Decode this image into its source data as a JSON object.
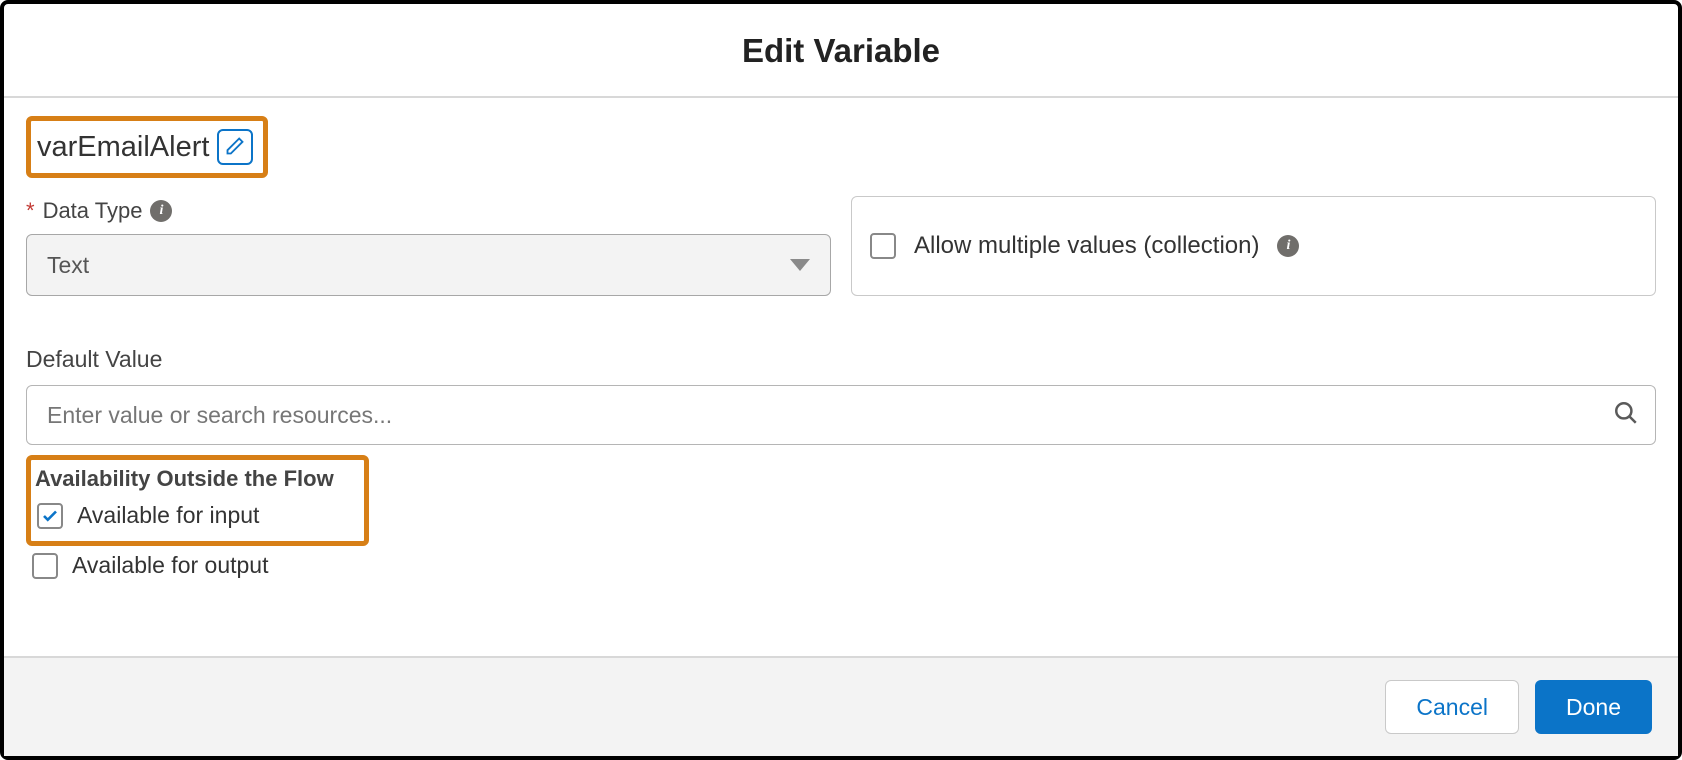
{
  "header": {
    "title": "Edit Variable"
  },
  "variable": {
    "name": "varEmailAlert"
  },
  "dataType": {
    "label": "Data Type",
    "value": "Text"
  },
  "allowMultiple": {
    "label": "Allow multiple values (collection)",
    "checked": false
  },
  "defaultValue": {
    "label": "Default Value",
    "placeholder": "Enter value or search resources..."
  },
  "availability": {
    "title": "Availability Outside the Flow",
    "input": {
      "label": "Available for input",
      "checked": true
    },
    "output": {
      "label": "Available for output",
      "checked": false
    }
  },
  "footer": {
    "cancel": "Cancel",
    "done": "Done"
  }
}
